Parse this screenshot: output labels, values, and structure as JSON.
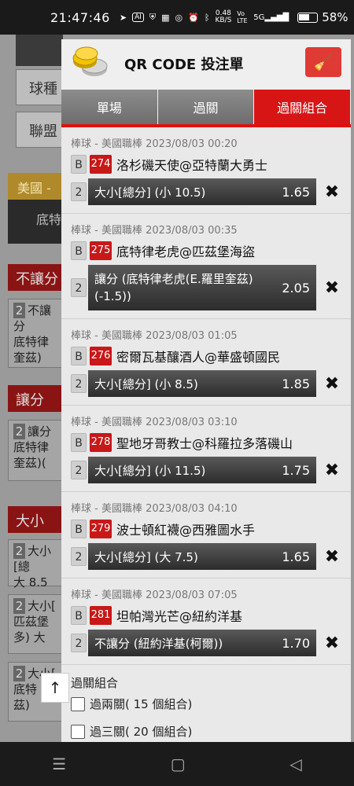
{
  "status_bar": {
    "time": "21:47:46",
    "icons": [
      "navigation-icon",
      "ai-icon",
      "shield-icon",
      "app-icon",
      "instagram-icon",
      "alarm-icon",
      "bluetooth-icon"
    ],
    "net_speed": "0.48",
    "net_unit": "KB/S",
    "network": "Vo LTE",
    "signal": "5G",
    "battery": "58%"
  },
  "background": {
    "buttons": [
      "球種",
      "聯盟"
    ],
    "gold_label": "美國 -",
    "dark_label": "底特",
    "sections": [
      "不讓分",
      "讓分",
      "大小"
    ],
    "rows": [
      {
        "num": "2",
        "label": "不讓分"
      },
      {
        "num": "",
        "label": "底特律 奎茲)"
      },
      {
        "num": "2",
        "label": "讓分"
      },
      {
        "num": "",
        "label": "底特律 奎茲)("
      },
      {
        "num": "2",
        "label": "大小[總"
      },
      {
        "num": "",
        "label": "大 8.5"
      },
      {
        "num": "2",
        "label": "大小["
      },
      {
        "num": "",
        "label": "匹茲堡 多) 大"
      },
      {
        "num": "2",
        "label": "大小["
      },
      {
        "num": "",
        "label": "底特 奎茲)"
      }
    ]
  },
  "modal": {
    "title": "QR CODE 投注單",
    "clear_icon": "broom-icon",
    "tabs": [
      {
        "label": "單場",
        "active": false
      },
      {
        "label": "過關",
        "active": false
      },
      {
        "label": "過關組合",
        "active": true
      }
    ],
    "bets": [
      {
        "meta": "棒球 - 美國職棒 2023/08/03 00:20",
        "tag": "B",
        "code": "274",
        "match": "洛杉磯天使@亞特蘭大勇士",
        "count": "2",
        "selection": "大小[總分] (小 10.5)",
        "odds": "1.65"
      },
      {
        "meta": "棒球 - 美國職棒 2023/08/03 00:35",
        "tag": "B",
        "code": "275",
        "match": "底特律老虎@匹茲堡海盜",
        "count": "2",
        "selection": "讓分 (底特律老虎(E.羅里奎茲)(-1.5))",
        "odds": "2.05"
      },
      {
        "meta": "棒球 - 美國職棒 2023/08/03 01:05",
        "tag": "B",
        "code": "276",
        "match": "密爾瓦基釀酒人@華盛頓國民",
        "count": "2",
        "selection": "大小[總分] (小 8.5)",
        "odds": "1.85"
      },
      {
        "meta": "棒球 - 美國職棒 2023/08/03 03:10",
        "tag": "B",
        "code": "278",
        "match": "聖地牙哥教士@科羅拉多落磯山",
        "count": "2",
        "selection": "大小[總分] (小 11.5)",
        "odds": "1.75"
      },
      {
        "meta": "棒球 - 美國職棒 2023/08/03 04:10",
        "tag": "B",
        "code": "279",
        "match": "波士頓紅襪@西雅圖水手",
        "count": "2",
        "selection": "大小[總分] (大 7.5)",
        "odds": "1.65"
      },
      {
        "meta": "棒球 - 美國職棒 2023/08/03 07:05",
        "tag": "B",
        "code": "281",
        "match": "坦帕灣光芒@紐約洋基",
        "count": "2",
        "selection": "不讓分 (紐約洋基(柯爾))",
        "odds": "1.70"
      }
    ],
    "combo": {
      "title": "過關組合",
      "options": [
        "過兩關( 15 個組合)",
        "過三關( 20 個組合)"
      ]
    },
    "scroll_top_icon": "arrow-up-icon"
  },
  "nav_bar": {
    "icons": [
      "menu-icon",
      "home-icon",
      "back-icon"
    ]
  }
}
